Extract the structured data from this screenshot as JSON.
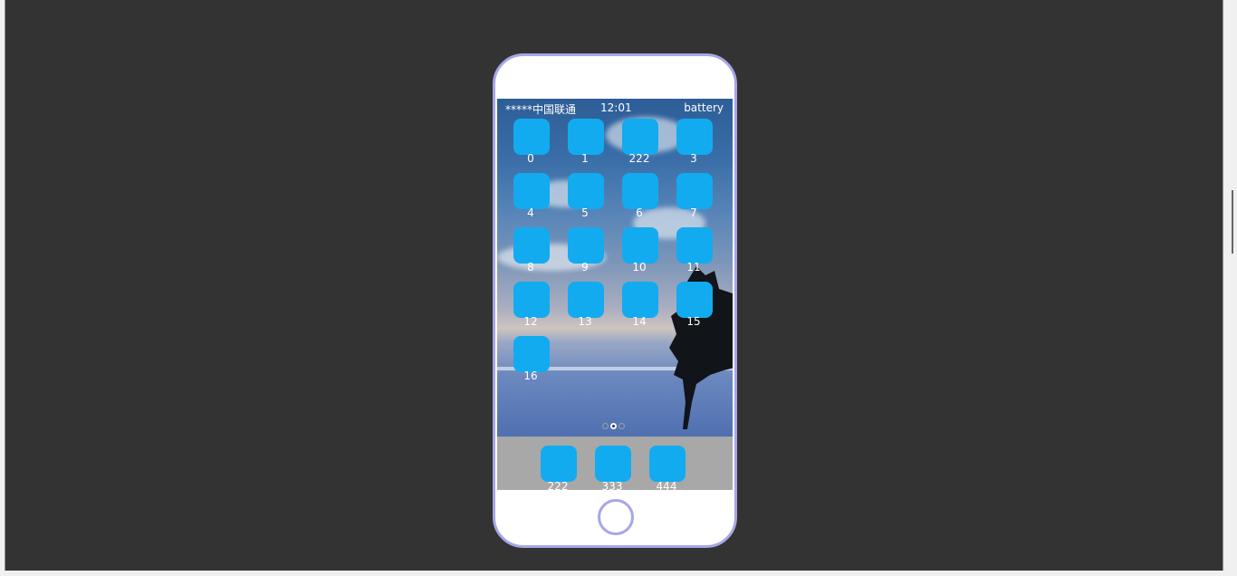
{
  "status_bar": {
    "carrier": "*****中国联通",
    "time": "12:01",
    "battery": "battery"
  },
  "home_apps": [
    {
      "label": "0"
    },
    {
      "label": "1"
    },
    {
      "label": "222"
    },
    {
      "label": "3"
    },
    {
      "label": "4"
    },
    {
      "label": "5"
    },
    {
      "label": "6"
    },
    {
      "label": "7"
    },
    {
      "label": "8"
    },
    {
      "label": "9"
    },
    {
      "label": "10"
    },
    {
      "label": "11"
    },
    {
      "label": "12"
    },
    {
      "label": "13"
    },
    {
      "label": "14"
    },
    {
      "label": "15"
    },
    {
      "label": "16"
    }
  ],
  "page_indicator": {
    "pages": 3,
    "current_page": 2
  },
  "dock_apps": [
    {
      "label": "222"
    },
    {
      "label": "333"
    },
    {
      "label": "444"
    }
  ],
  "colors": {
    "app_icon": "#12abef",
    "phone_border": "#a7a6e8",
    "dock_background": "#a8a8a8",
    "page_background": "#333333"
  },
  "icons": {
    "app": "rounded-square-app-icon",
    "home": "home-button-circle"
  }
}
